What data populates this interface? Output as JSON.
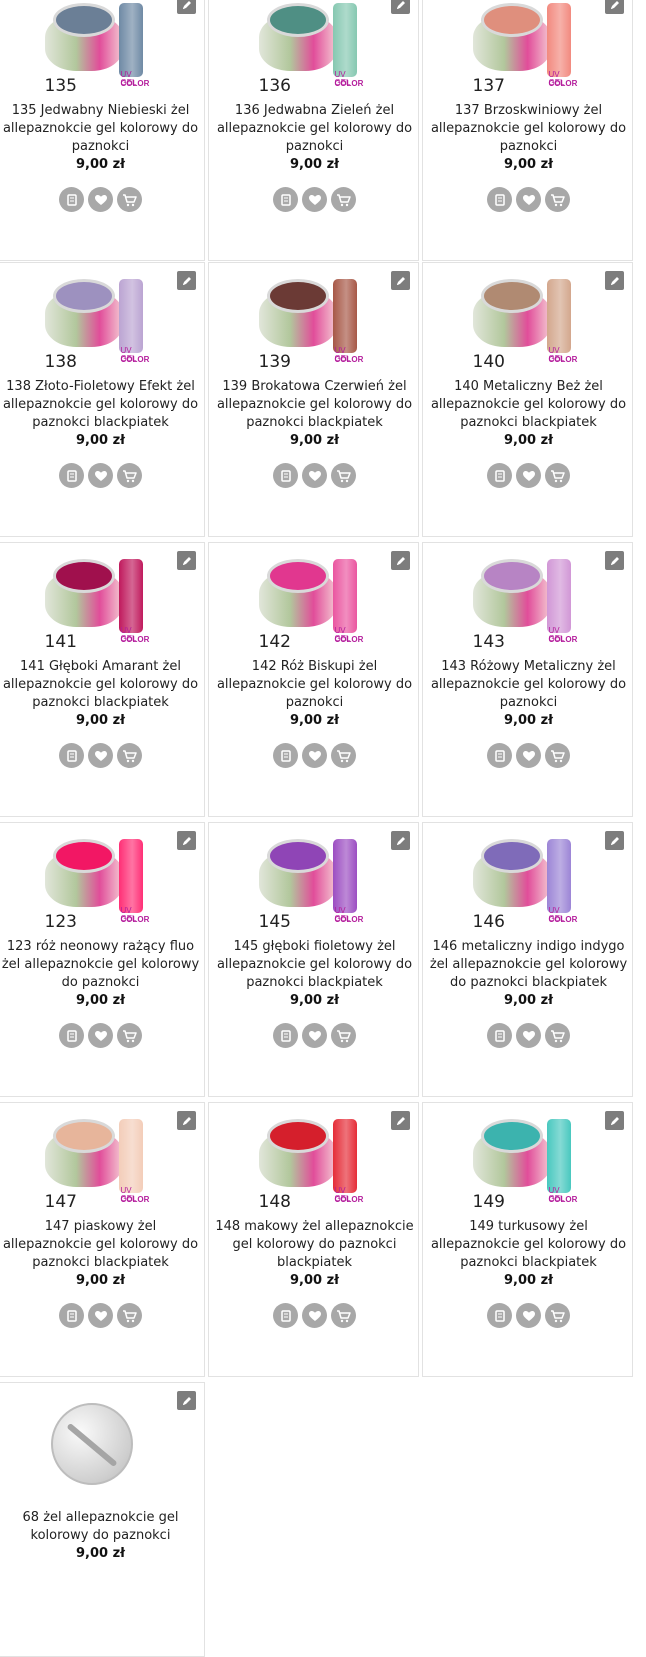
{
  "products": [
    {
      "number": "135",
      "title": "135 Jedwabny Niebieski żel allepaznokcie gel kolorowy do paznokci",
      "price": "9,00 zł",
      "color": "#6b7f96",
      "swatch": "#6f8aa5"
    },
    {
      "number": "136",
      "title": "136 Jedwabna Zieleń żel allepaznokcie gel kolorowy do paznokci",
      "price": "9,00 zł",
      "color": "#4f8f84",
      "swatch": "#86c8b1"
    },
    {
      "number": "137",
      "title": "137 Brzoskwiniowy żel allepaznokcie gel kolorowy do paznokci",
      "price": "9,00 zł",
      "color": "#df8f7d",
      "swatch": "#f28a7f"
    },
    {
      "number": "138",
      "title": "138 Złoto-Fioletowy Efekt żel allepaznokcie gel kolorowy do paznokci blackpiatek",
      "price": "9,00 zł",
      "color": "#9d91bf",
      "swatch": "#bba4d2"
    },
    {
      "number": "139",
      "title": "139 Brokatowa Czerwień żel allepaznokcie gel kolorowy do paznokci blackpiatek",
      "price": "9,00 zł",
      "color": "#6b3a35",
      "swatch": "#a75847"
    },
    {
      "number": "140",
      "title": "140 Metaliczny Beż żel allepaznokcie gel kolorowy do paznokci blackpiatek",
      "price": "9,00 zł",
      "color": "#b08a72",
      "swatch": "#d3a78d"
    },
    {
      "number": "141",
      "title": "141 Głęboki Amarant żel allepaznokcie gel kolorowy do paznokci blackpiatek",
      "price": "9,00 zł",
      "color": "#a0104d",
      "swatch": "#c01a5d"
    },
    {
      "number": "142",
      "title": "142 Róż Biskupi żel allepaznokcie gel kolorowy do paznokci",
      "price": "9,00 zł",
      "color": "#e1378f",
      "swatch": "#ea56a0"
    },
    {
      "number": "143",
      "title": "143 Różowy Metaliczny żel allepaznokcie gel kolorowy do paznokci",
      "price": "9,00 zł",
      "color": "#b784c4",
      "swatch": "#d197d6"
    },
    {
      "number": "123",
      "title": "123 róż neonowy rażący fluo żel allepaznokcie gel kolorowy do paznokci",
      "price": "9,00 zł",
      "color": "#f21764",
      "swatch": "#ff2f76"
    },
    {
      "number": "145",
      "title": "145 głęboki fioletowy żel allepaznokcie gel kolorowy do paznokci blackpiatek",
      "price": "9,00 zł",
      "color": "#8f45b6",
      "swatch": "#9c4ec2"
    },
    {
      "number": "146",
      "title": "146 metaliczny indigo indygo żel allepaznokcie gel kolorowy do paznokci blackpiatek",
      "price": "9,00 zł",
      "color": "#7f6bb9",
      "swatch": "#9c85d6"
    },
    {
      "number": "147",
      "title": "147 piaskowy żel allepaznokcie gel kolorowy do paznokci blackpiatek",
      "price": "9,00 zł",
      "color": "#e7b59b",
      "swatch": "#f3cdb9"
    },
    {
      "number": "148",
      "title": "148 makowy żel allepaznokcie gel kolorowy do paznokci blackpiatek",
      "price": "9,00 zł",
      "color": "#d51f2c",
      "swatch": "#e52d38"
    },
    {
      "number": "149",
      "title": "149 turkusowy żel allepaznokcie gel kolorowy do paznokci blackpiatek",
      "price": "9,00 zł",
      "color": "#3cb3ae",
      "swatch": "#49c8bf"
    },
    {
      "number": "",
      "title": "68 żel allepaznokcie gel kolorowy do paznokci",
      "price": "9,00 zł",
      "placeholder": true
    }
  ],
  "logo": {
    "uv": "UV GEL",
    "color": "COLOR"
  }
}
